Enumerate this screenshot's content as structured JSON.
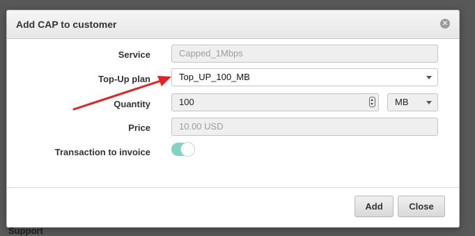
{
  "background": {
    "partial_text": "Support"
  },
  "dialog": {
    "title": "Add CAP to customer",
    "close_icon": "close-circle-icon",
    "fields": {
      "service": {
        "label": "Service",
        "value": "Capped_1Mbps"
      },
      "topup_plan": {
        "label": "Top-Up plan",
        "value": "Top_UP_100_MB"
      },
      "quantity": {
        "label": "Quantity",
        "value": "100",
        "unit": "MB"
      },
      "price": {
        "label": "Price",
        "value": "10.00 USD"
      },
      "transaction_to_invoice": {
        "label": "Transaction to invoice",
        "enabled": true
      }
    },
    "buttons": {
      "add": "Add",
      "close": "Close"
    }
  },
  "annotation": {
    "color": "#e8201f",
    "icon": "red-arrow"
  },
  "colors": {
    "toggle_on": "#7fd3c1"
  }
}
